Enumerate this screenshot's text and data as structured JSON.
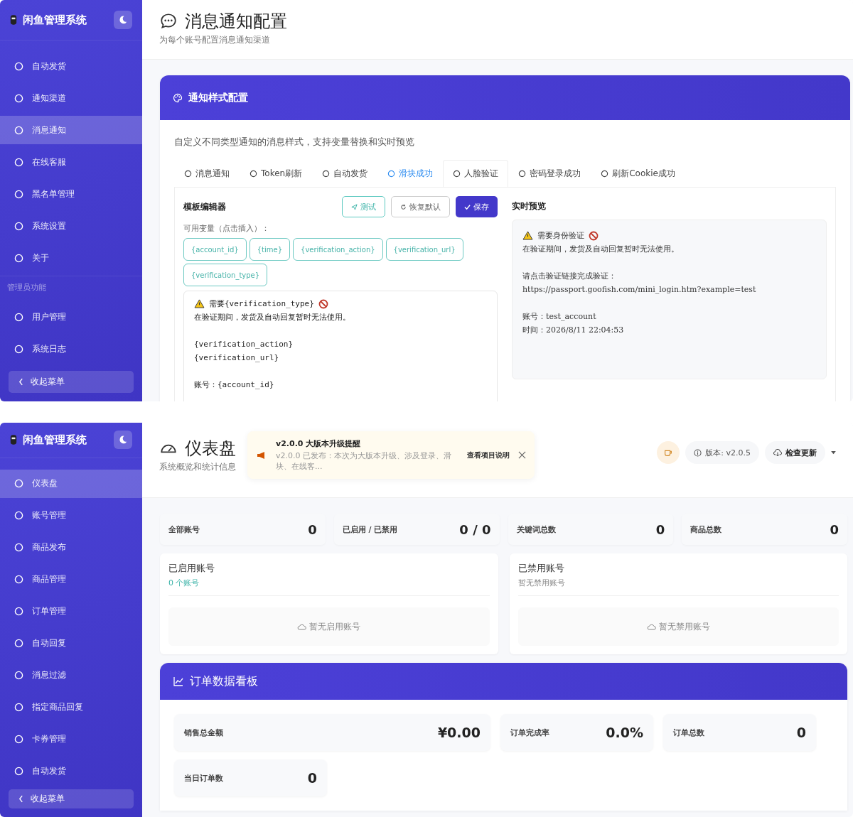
{
  "pages": [
    {
      "kind": "notification_settings",
      "sidebar": {
        "brand": "闲鱼管理系统",
        "collapse": "收起菜单",
        "items": [
          {
            "kind": "item",
            "label": "自动发货",
            "selected": false
          },
          {
            "kind": "item",
            "label": "通知渠道",
            "selected": false
          },
          {
            "kind": "item",
            "label": "消息通知",
            "selected": true
          },
          {
            "kind": "item",
            "label": "在线客服",
            "selected": false
          },
          {
            "kind": "item",
            "label": "黑名单管理",
            "selected": false
          },
          {
            "kind": "item",
            "label": "系统设置",
            "selected": false
          },
          {
            "kind": "item",
            "label": "关于",
            "selected": false
          },
          {
            "kind": "section",
            "label": "管理员功能"
          },
          {
            "kind": "item",
            "label": "用户管理",
            "selected": false
          },
          {
            "kind": "item",
            "label": "系统日志",
            "selected": false
          }
        ]
      },
      "header": {
        "title": "消息通知配置",
        "subtitle": "为每个账号配置消息通知渠道"
      },
      "card": {
        "title": "通知样式配置",
        "description": "自定义不同类型通知的消息样式，支持变量替换和实时预览",
        "tabs": [
          {
            "label": "消息通知",
            "selected": false,
            "highlighted": false
          },
          {
            "label": "Token刷新",
            "selected": false,
            "highlighted": false
          },
          {
            "label": "自动发货",
            "selected": false,
            "highlighted": false
          },
          {
            "label": "滑块成功",
            "selected": false,
            "highlighted": true
          },
          {
            "label": "人脸验证",
            "selected": true,
            "highlighted": false
          },
          {
            "label": "密码登录成功",
            "selected": false,
            "highlighted": false
          },
          {
            "label": "刷新Cookie成功",
            "selected": false,
            "highlighted": false
          }
        ],
        "editor": {
          "title": "模板编辑器",
          "buttons": [
            {
              "kind": "test",
              "label": "测试"
            },
            {
              "kind": "reset",
              "label": "恢复默认"
            },
            {
              "kind": "save",
              "label": "保存"
            }
          ],
          "variables_label": "可用变量（点击插入）：",
          "variables": [
            "{account_id}",
            "{time}",
            "{verification_action}",
            "{verification_url}",
            "{verification_type}"
          ],
          "heading": "需要{verification_type}",
          "body": [
            [
              "在验证期间，发货及自动回复暂时无法使用。"
            ],
            [
              "{verification_action}",
              "{verification_url}"
            ],
            [
              "账号：{account_id}"
            ]
          ]
        },
        "preview": {
          "title": "实时预览",
          "heading": "需要身份验证",
          "body": [
            [
              "在验证期间，发货及自动回复暂时无法使用。"
            ],
            [
              "请点击验证链接完成验证：",
              "https://passport.goofish.com/mini_login.htm?example=test"
            ],
            [
              "账号：test_account",
              "时间：2026/8/11 22:04:53"
            ]
          ]
        }
      }
    },
    {
      "kind": "dashboard",
      "sidebar": {
        "brand": "闲鱼管理系统",
        "collapse": "收起菜单",
        "items": [
          {
            "kind": "item",
            "label": "仪表盘",
            "selected": true
          },
          {
            "kind": "item",
            "label": "账号管理",
            "selected": false
          },
          {
            "kind": "item",
            "label": "商品发布",
            "selected": false
          },
          {
            "kind": "item",
            "label": "商品管理",
            "selected": false
          },
          {
            "kind": "item",
            "label": "订单管理",
            "selected": false
          },
          {
            "kind": "item",
            "label": "自动回复",
            "selected": false
          },
          {
            "kind": "item",
            "label": "消息过滤",
            "selected": false
          },
          {
            "kind": "item",
            "label": "指定商品回复",
            "selected": false
          },
          {
            "kind": "item",
            "label": "卡券管理",
            "selected": false
          },
          {
            "kind": "item",
            "label": "自动发货",
            "selected": false
          }
        ]
      },
      "header": {
        "title": "仪表盘",
        "subtitle": "系统概览和统计信息"
      },
      "notice": {
        "title": "v2.0.0 大版本升级提醒",
        "text": "v2.0.0 已发布：本次为大版本升级、涉及登录、滑块、在线客...",
        "link": "查看项目说明"
      },
      "version": "版本: v2.0.5",
      "update_button": "检查更新",
      "stats": [
        {
          "label": "全部账号",
          "value": "0"
        },
        {
          "label": "已启用 / 已禁用",
          "value": "0 / 0"
        },
        {
          "label": "关键词总数",
          "value": "0"
        },
        {
          "label": "商品总数",
          "value": "0"
        }
      ],
      "account_panels": [
        {
          "title": "已启用账号",
          "subtitle": "0 个账号",
          "highlighted": true,
          "empty": "暂无启用账号"
        },
        {
          "title": "已禁用账号",
          "subtitle": "暂无禁用账号",
          "highlighted": false,
          "empty": "暂无禁用账号"
        }
      ],
      "orders": {
        "title": "订单数据看板",
        "metrics": [
          {
            "label": "销售总金额",
            "value": "¥0.00",
            "wide": true
          },
          {
            "label": "订单完成率",
            "value": "0.0%",
            "wide": false
          },
          {
            "label": "订单总数",
            "value": "0",
            "wide": false
          },
          {
            "label": "当日订单数",
            "value": "0",
            "wide": false
          }
        ]
      }
    }
  ]
}
